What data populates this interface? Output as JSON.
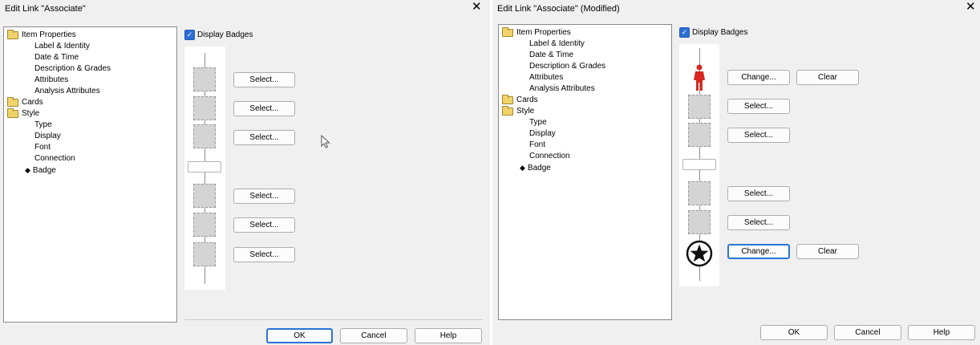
{
  "left_dialog": {
    "title": "Edit Link \"Associate\"",
    "close": "✕",
    "tree": {
      "item_properties": "Item Properties",
      "label_identity": "Label & Identity",
      "date_time": "Date & Time",
      "description_grades": "Description & Grades",
      "attributes": "Attributes",
      "analysis_attributes": "Analysis Attributes",
      "cards": "Cards",
      "style": "Style",
      "type": "Type",
      "display": "Display",
      "font": "Font",
      "connection": "Connection",
      "badge": "Badge",
      "selected_marker": "◆"
    },
    "display_badges": "Display Badges",
    "checkmark": "✓",
    "slot_buttons": [
      "Select...",
      "Select...",
      "Select...",
      "Select...",
      "Select...",
      "Select..."
    ],
    "ok": "OK",
    "cancel": "Cancel",
    "help": "Help"
  },
  "right_dialog": {
    "title": "Edit Link \"Associate\" (Modified)",
    "close": "✕",
    "tree": {
      "item_properties": "Item Properties",
      "label_identity": "Label & Identity",
      "date_time": "Date & Time",
      "description_grades": "Description & Grades",
      "attributes": "Attributes",
      "analysis_attributes": "Analysis Attributes",
      "cards": "Cards",
      "style": "Style",
      "type": "Type",
      "display": "Display",
      "font": "Font",
      "connection": "Connection",
      "badge": "Badge",
      "selected_marker": "◆"
    },
    "display_badges": "Display Badges",
    "checkmark": "✓",
    "top_badge_change": "Change...",
    "top_badge_clear": "Clear",
    "slot_buttons": [
      "Select...",
      "Select...",
      "Select...",
      "Select..."
    ],
    "bottom_badge_change": "Change...",
    "bottom_badge_clear": "Clear",
    "ok": "OK",
    "cancel": "Cancel",
    "help": "Help",
    "badge_colors": {
      "person": "#d6281e",
      "star": "#111111"
    }
  }
}
